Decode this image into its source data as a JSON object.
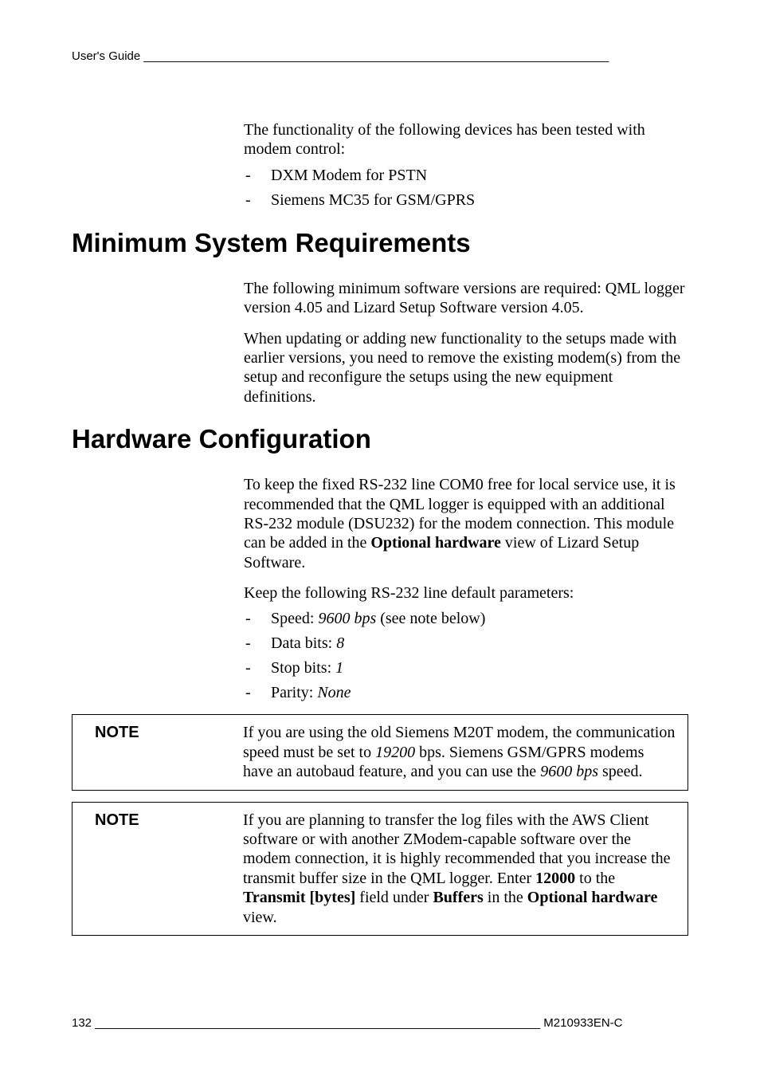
{
  "header": {
    "left": "User's Guide ______________________________________________________________________"
  },
  "intro": {
    "p1": "The functionality of the following devices has been tested with modem control:",
    "bullets": [
      "DXM Modem for PSTN",
      "Siemens MC35 for GSM/GPRS"
    ]
  },
  "section1": {
    "heading": "Minimum System Requirements",
    "p1": "The following minimum software versions are required: QML logger version 4.05 and Lizard Setup Software version 4.05.",
    "p2": "When updating or adding new functionality to the setups made with earlier versions, you need to remove the existing modem(s) from the setup and reconfigure the setups using the new equipment definitions."
  },
  "section2": {
    "heading": "Hardware Configuration",
    "p1_pre": "To keep the fixed RS-232 line COM0 free for local service use, it is recommended that the QML logger is equipped with an additional RS-232 module (DSU232) for the modem connection. This module can be added in the ",
    "p1_bold": "Optional hardware",
    "p1_post": " view of Lizard Setup Software.",
    "p2": "Keep the following RS-232 line default parameters:",
    "bullets": {
      "b1_pre": "Speed: ",
      "b1_em": "9600 bps",
      "b1_post": " (see note below)",
      "b2_pre": "Data bits: ",
      "b2_em": "8",
      "b3_pre": "Stop bits: ",
      "b3_em": "1",
      "b4_pre": "Parity: ",
      "b4_em": "None"
    }
  },
  "note1": {
    "label": "NOTE",
    "t1": "If you are using the old Siemens M20T modem, the communication speed must be set to ",
    "em1": "19200",
    "t2": " bps. Siemens GSM/GPRS modems have an autobaud feature, and you can use the ",
    "em2": "9600 bps",
    "t3": " speed."
  },
  "note2": {
    "label": "NOTE",
    "t1": "If you are planning to transfer the log files with the AWS Client software or with another ZModem-capable software over the modem connection, it is highly recommended that you increase the transmit buffer size in the QML logger. Enter ",
    "b1": "12000",
    "t2": " to the ",
    "b2": "Transmit [bytes]",
    "t3": " field under ",
    "b3": "Buffers",
    "t4": " in the ",
    "b4": "Optional hardware",
    "t5": " view."
  },
  "footer": {
    "left": "132 ___________________________________________________________________ M210933EN-C"
  }
}
